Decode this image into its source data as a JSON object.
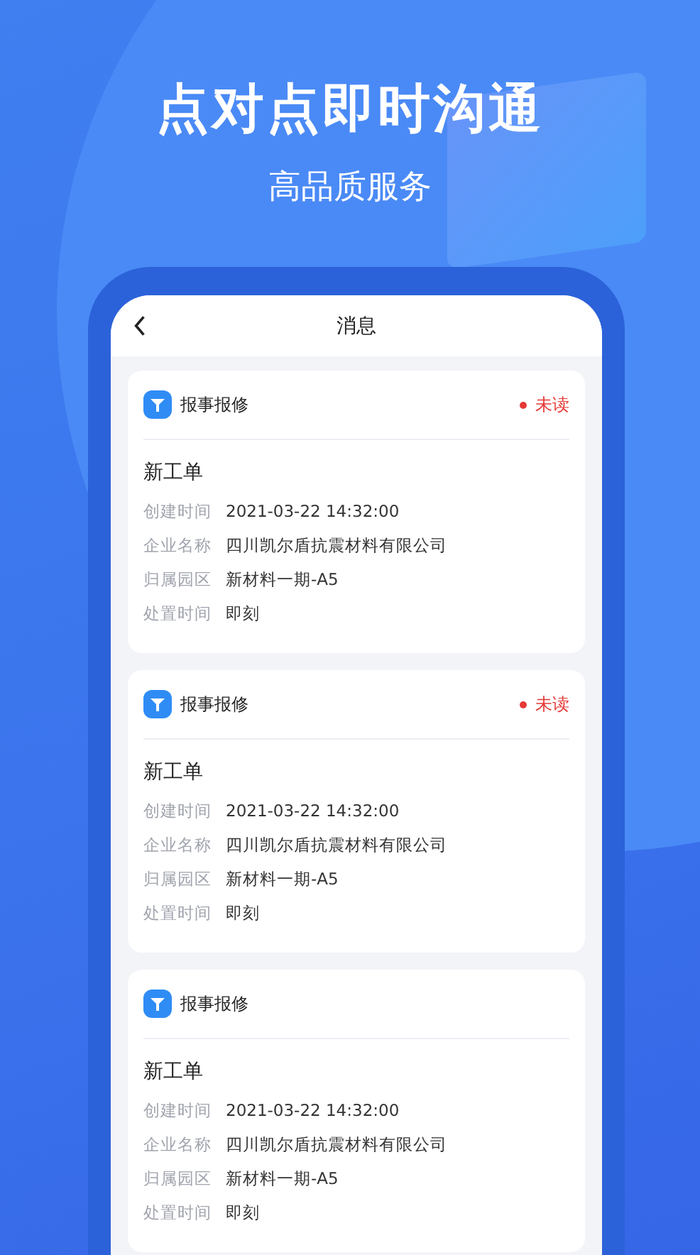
{
  "headline": "点对点即时沟通",
  "subheadline": "高品质服务",
  "screen": {
    "title": "消息"
  },
  "messages": [
    {
      "category": "报事报修",
      "unread": true,
      "unread_label": "未读",
      "title": "新工单",
      "fields": [
        {
          "label": "创建时间",
          "value": "2021-03-22 14:32:00"
        },
        {
          "label": "企业名称",
          "value": "四川凯尔盾抗震材料有限公司"
        },
        {
          "label": "归属园区",
          "value": "新材料一期-A5"
        },
        {
          "label": "处置时间",
          "value": "即刻"
        }
      ]
    },
    {
      "category": "报事报修",
      "unread": true,
      "unread_label": "未读",
      "title": "新工单",
      "fields": [
        {
          "label": "创建时间",
          "value": "2021-03-22 14:32:00"
        },
        {
          "label": "企业名称",
          "value": "四川凯尔盾抗震材料有限公司"
        },
        {
          "label": "归属园区",
          "value": "新材料一期-A5"
        },
        {
          "label": "处置时间",
          "value": "即刻"
        }
      ]
    },
    {
      "category": "报事报修",
      "unread": false,
      "title": "新工单",
      "fields": [
        {
          "label": "创建时间",
          "value": "2021-03-22 14:32:00"
        },
        {
          "label": "企业名称",
          "value": "四川凯尔盾抗震材料有限公司"
        },
        {
          "label": "归属园区",
          "value": "新材料一期-A5"
        },
        {
          "label": "处置时间",
          "value": "即刻"
        }
      ]
    }
  ]
}
